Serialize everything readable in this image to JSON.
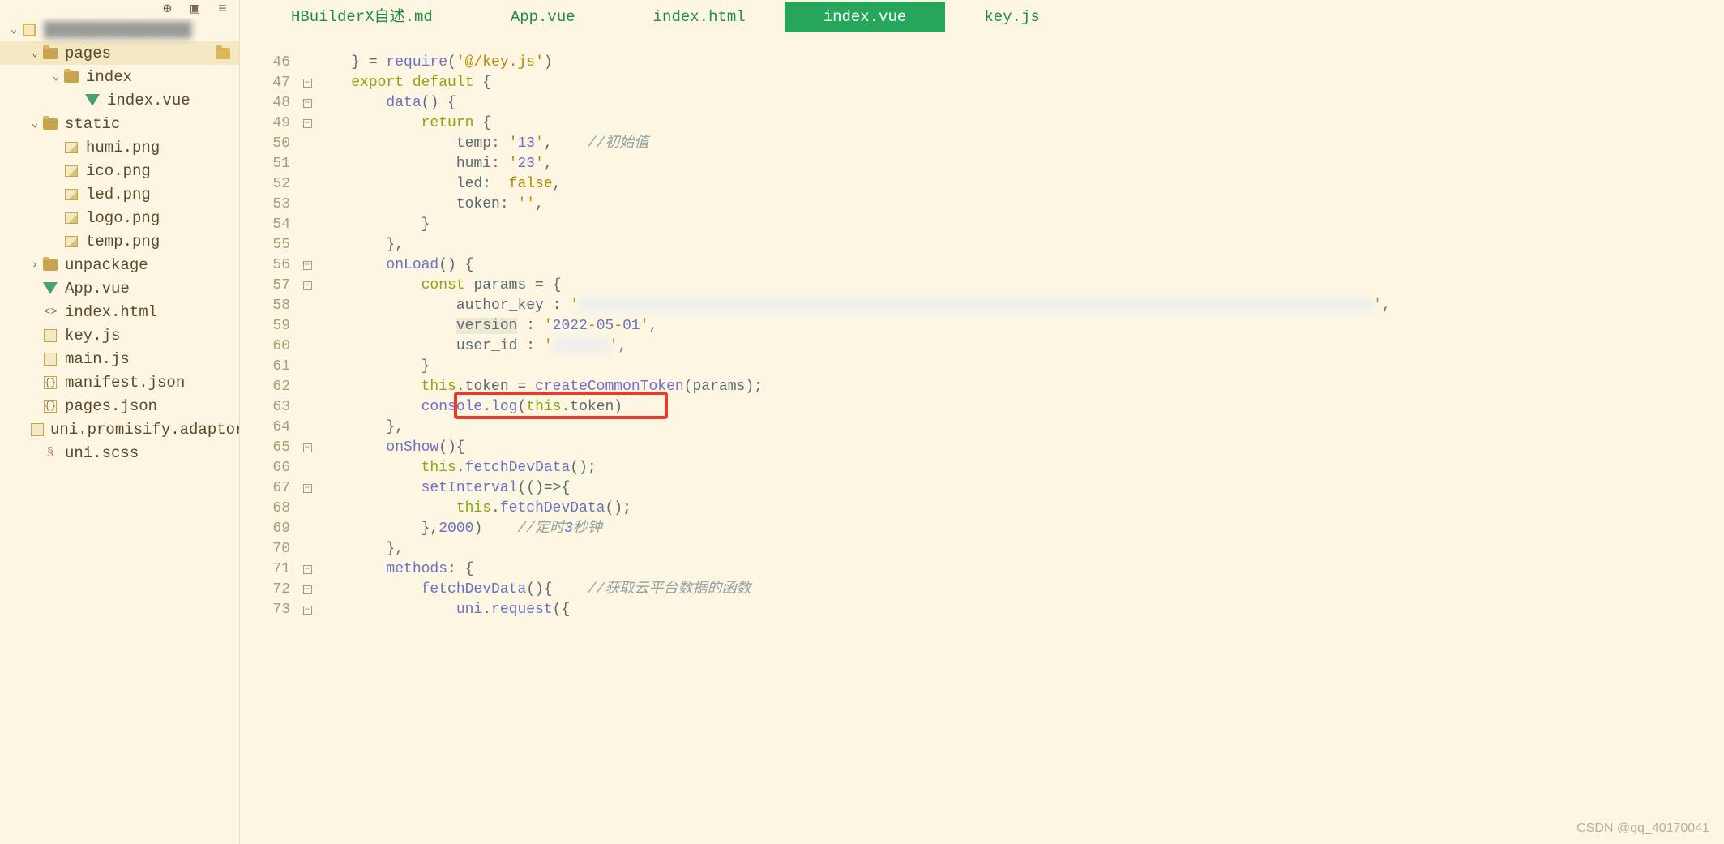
{
  "toolbar_icons": [
    "target-icon",
    "sidebar-toggle-icon",
    "menu-icon"
  ],
  "file_tree": {
    "root": {
      "name_blurred": true
    },
    "nodes": [
      {
        "kind": "folder",
        "name": "pages",
        "depth": 1,
        "open": true,
        "selected": true,
        "trailing": "folder"
      },
      {
        "kind": "folder",
        "name": "index",
        "depth": 2,
        "open": true
      },
      {
        "kind": "vue",
        "name": "index.vue",
        "depth": 3
      },
      {
        "kind": "folder",
        "name": "static",
        "depth": 1,
        "open": true
      },
      {
        "kind": "image",
        "name": "humi.png",
        "depth": 2
      },
      {
        "kind": "image",
        "name": "ico.png",
        "depth": 2
      },
      {
        "kind": "image",
        "name": "led.png",
        "depth": 2
      },
      {
        "kind": "image",
        "name": "logo.png",
        "depth": 2
      },
      {
        "kind": "image",
        "name": "temp.png",
        "depth": 2
      },
      {
        "kind": "folder",
        "name": "unpackage",
        "depth": 1,
        "open": false,
        "chev": "right"
      },
      {
        "kind": "vue",
        "name": "App.vue",
        "depth": 1
      },
      {
        "kind": "html",
        "name": "index.html",
        "depth": 1
      },
      {
        "kind": "js",
        "name": "key.js",
        "depth": 1
      },
      {
        "kind": "js",
        "name": "main.js",
        "depth": 1
      },
      {
        "kind": "json",
        "name": "manifest.json",
        "depth": 1
      },
      {
        "kind": "json",
        "name": "pages.json",
        "depth": 1
      },
      {
        "kind": "js",
        "name": "uni.promisify.adaptor.js",
        "depth": 1
      },
      {
        "kind": "scss",
        "name": "uni.scss",
        "depth": 1
      }
    ]
  },
  "tabs": [
    {
      "label": "HBuilderX自述.md",
      "active": false
    },
    {
      "label": "App.vue",
      "active": false
    },
    {
      "label": "index.html",
      "active": false
    },
    {
      "label": "index.vue",
      "active": true
    },
    {
      "label": "key.js",
      "active": false
    }
  ],
  "code": {
    "first_line_no": 46,
    "lines": [
      {
        "n": 46,
        "raw": "    } = require('@/key.js')",
        "fold": ""
      },
      {
        "n": 47,
        "raw": "    export default {",
        "fold": "-"
      },
      {
        "n": 48,
        "raw": "        data() {",
        "fold": "-"
      },
      {
        "n": 49,
        "raw": "            return {",
        "fold": "-"
      },
      {
        "n": 50,
        "raw": "                temp: '13',    //初始值"
      },
      {
        "n": 51,
        "raw": "                humi: '23',"
      },
      {
        "n": 52,
        "raw": "                led:  false,"
      },
      {
        "n": 53,
        "raw": "                token: '',"
      },
      {
        "n": 54,
        "raw": "            }"
      },
      {
        "n": 55,
        "raw": "        },"
      },
      {
        "n": 56,
        "raw": "        onLoad() {",
        "fold": "-"
      },
      {
        "n": 57,
        "raw": "            const params = {",
        "fold": "-"
      },
      {
        "n": 58,
        "raw": "                author_key : 'BLURRED',"
      },
      {
        "n": 59,
        "raw": "                version : '2022-05-01',"
      },
      {
        "n": 60,
        "raw": "                user_id : 'BLUR',"
      },
      {
        "n": 61,
        "raw": "            }"
      },
      {
        "n": 62,
        "raw": "            this.token = createCommonToken(params);"
      },
      {
        "n": 63,
        "raw": "            console.log(this.token)",
        "highlight_box": true
      },
      {
        "n": 64,
        "raw": "        },"
      },
      {
        "n": 65,
        "raw": "        onShow(){",
        "fold": "-"
      },
      {
        "n": 66,
        "raw": "            this.fetchDevData();"
      },
      {
        "n": 67,
        "raw": "            setInterval(()=>{",
        "fold": "-"
      },
      {
        "n": 68,
        "raw": "                this.fetchDevData();"
      },
      {
        "n": 69,
        "raw": "            },2000)    //定时3秒钟"
      },
      {
        "n": 70,
        "raw": "        },"
      },
      {
        "n": 71,
        "raw": "        methods: {",
        "fold": "-"
      },
      {
        "n": 72,
        "raw": "            fetchDevData(){    //获取云平台数据的函数",
        "fold": "-"
      },
      {
        "n": 73,
        "raw": "                uni.request({",
        "fold": "-"
      }
    ]
  },
  "watermark": "CSDN @qq_40170041"
}
